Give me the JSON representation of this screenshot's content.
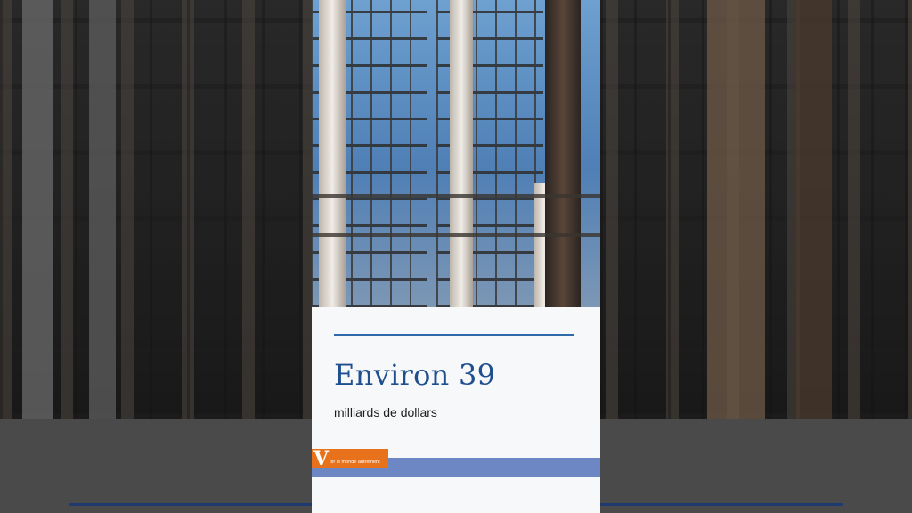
{
  "card": {
    "headline": "Environ 39",
    "subtitle": "milliards de dollars"
  },
  "logo": {
    "letter": "V",
    "tagline": "oir le monde autrement"
  },
  "colors": {
    "headline": "#1f4f8f",
    "rule": "#2f6aa8",
    "bar": "#6d86c4",
    "logo": "#e8711b",
    "card": "#f7f8fa"
  }
}
